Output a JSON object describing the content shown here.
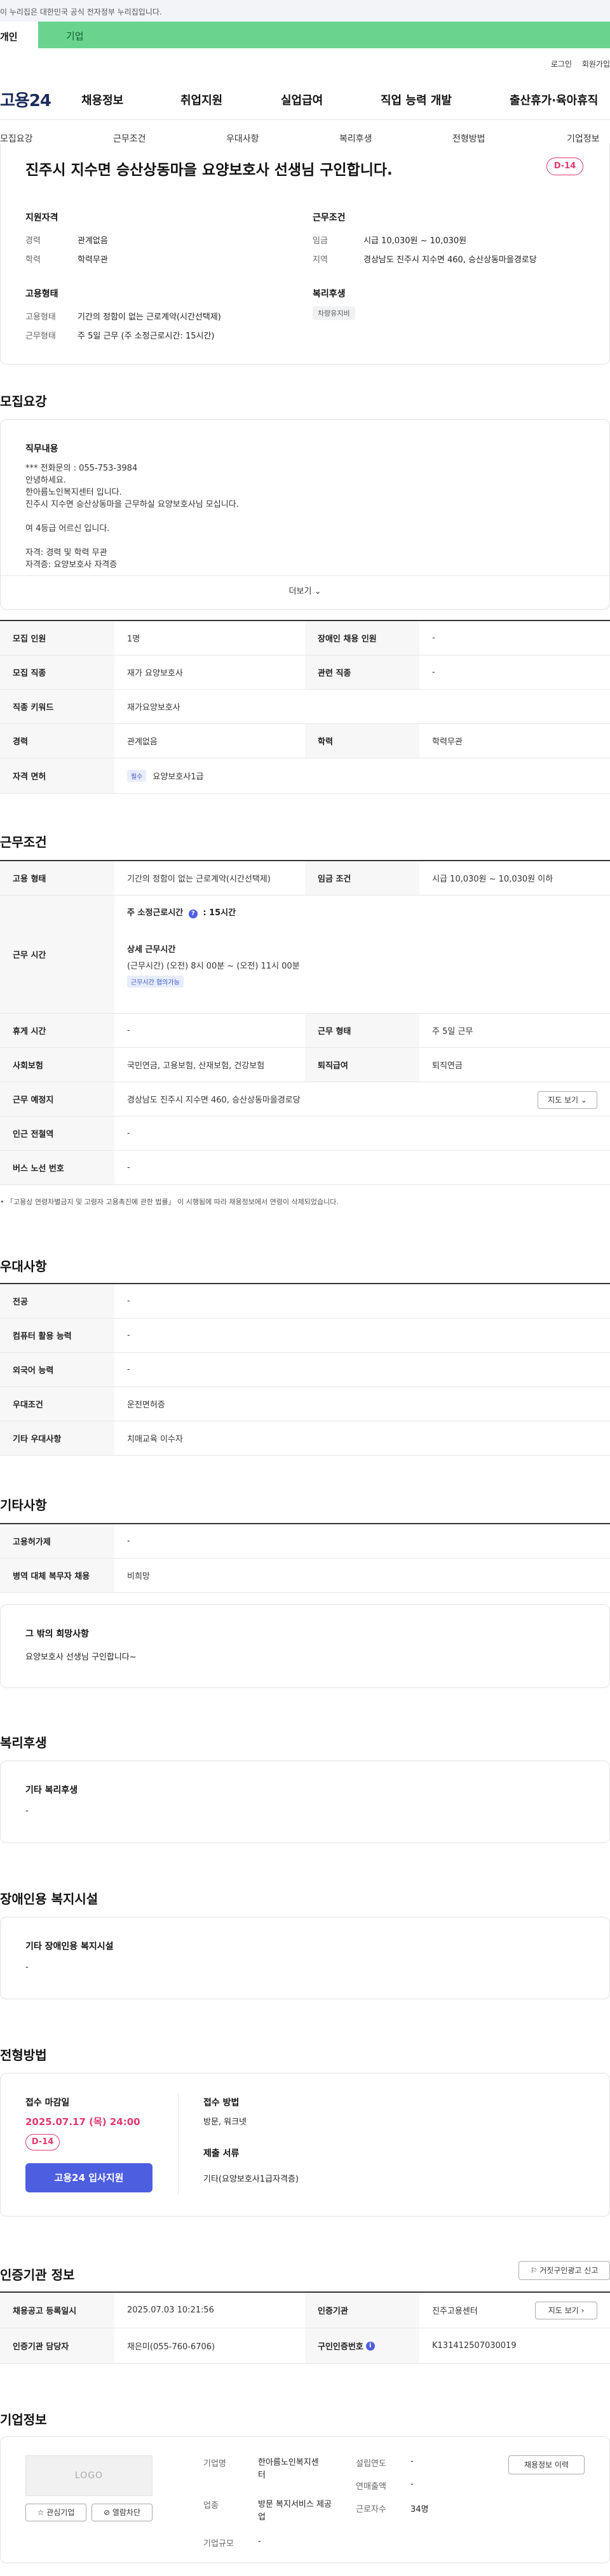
{
  "gov_banner": "이 누리집은 대한민국 공식 전자정부 누리집입니다.",
  "user_types": {
    "person": "개인",
    "company": "기업"
  },
  "util": {
    "login": "로그인",
    "signup": "회원가입"
  },
  "gnb": {
    "logo": "고용24",
    "items": [
      "채용정보",
      "취업지원",
      "실업급여",
      "직업 능력 개발",
      "출산휴가·육아휴직"
    ]
  },
  "subtabs": [
    "모집요강",
    "근무조건",
    "우대사항",
    "복리후생",
    "전형방법",
    "기업정보"
  ],
  "job": {
    "title": "진주시 지수면 승산상동마을 요양보호사 선생님 구인합니다.",
    "dday": "D-14",
    "qual_title": "지원자격",
    "qual": [
      {
        "k": "경력",
        "v": "관계없음"
      },
      {
        "k": "학력",
        "v": "학력무관"
      }
    ],
    "cond_title": "근무조건",
    "cond": [
      {
        "k": "임금",
        "v": "시급 10,030원 ~ 10,030원"
      },
      {
        "k": "지역",
        "v": "경상남도 진주시 지수면 460, 승산상동마을경로당"
      }
    ],
    "emp_title": "고용형태",
    "emp": [
      {
        "k": "고용형태",
        "v": "기간의 정함이 없는 근로계약(시간선택제)"
      },
      {
        "k": "근무형태",
        "v": "주 5일 근무 (주 소정근로시간: 15시간)"
      }
    ],
    "welfare_title": "복리후생",
    "welfare_tag": "차량유지비"
  },
  "recruit": {
    "heading": "모집요강",
    "duty_title": "직무내용",
    "duty_lines": [
      "*** 전화문의 : 055-753-3984",
      "안녕하세요.",
      "한아름노인복지센터 입니다.",
      "진주시 지수면 승산상동마을 근무하실 요양보호사님 모십니다.",
      "",
      "여 4등급 어르신 입니다.",
      "",
      "자격: 경력 및 학력 무관",
      "자격증: 요양보호사 자격증"
    ],
    "more": "더보기",
    "rows": [
      {
        "k1": "모집 인원",
        "v1": "1명",
        "k2": "장애인 채용 인원",
        "v2": "-"
      },
      {
        "k1": "모집 직종",
        "v1": "재가 요양보호사",
        "k2": "관련 직종",
        "v2": "-"
      },
      {
        "k1": "직종 키워드",
        "v1": "재가요양보호사"
      },
      {
        "k1": "경력",
        "v1": "관계없음",
        "k2": "학력",
        "v2": "학력무관"
      },
      {
        "k1": "자격 면허",
        "v1_tag": "필수",
        "v1": "요양보호사1급"
      }
    ]
  },
  "work": {
    "heading": "근무조건",
    "r1": {
      "k1": "고용 형태",
      "v1": "기간의 정함이 없는 근로계약(시간선택제)",
      "k2": "임금 조건",
      "v2": "시급 10,030원 ~ 10,030원 이하"
    },
    "time": {
      "k": "근무 시간",
      "weekly_label": "주 소정근로시간",
      "weekly_value": "15시간",
      "detail_title": "상세 근무시간",
      "detail": "(근무시간) (오전) 8시 00분 ~ (오전) 11시 00분",
      "tag": "근무시간 협의가능"
    },
    "r3": {
      "k1": "휴게 시간",
      "v1": "-",
      "k2": "근무 형태",
      "v2": "주 5일 근무"
    },
    "r4": {
      "k1": "사회보험",
      "v1": "국민연금, 고용보험, 산재보험, 건강보험",
      "k2": "퇴직급여",
      "v2": "퇴직연금"
    },
    "r5": {
      "k1": "근무 예정지",
      "v1": "경상남도 진주시 지수면 460, 승산상동마을경로당",
      "btn": "지도 보기"
    },
    "r6": {
      "k1": "인근 전철역",
      "v1": "-"
    },
    "r7": {
      "k1": "버스 노선 번호",
      "v1": "-"
    },
    "note": "「고용상 연령차별금지 및 고령자 고용촉진에 관한 법률」 이 시행됨에 따라 채용정보에서 연령이 삭제되었습니다."
  },
  "pref": {
    "heading": "우대사항",
    "rows": [
      {
        "k": "전공",
        "v": "-"
      },
      {
        "k": "컴퓨터 활용 능력",
        "v": "-"
      },
      {
        "k": "외국어 능력",
        "v": "-"
      },
      {
        "k": "우대조건",
        "v": "운전면허증"
      },
      {
        "k": "기타 우대사항",
        "v": "치매교육 이수자"
      }
    ]
  },
  "etc": {
    "heading": "기타사항",
    "rows": [
      {
        "k": "고용허가제",
        "v": "-"
      },
      {
        "k": "병역 대체 복무자 채용",
        "v": "비희망"
      }
    ],
    "box_title": "그 밖의 희망사항",
    "box_text": "요양보호사 선생님 구인합니다~"
  },
  "benefit": {
    "heading": "복리후생",
    "box_title": "기타 복리후생",
    "box_text": "-"
  },
  "disability": {
    "heading": "장애인용 복지시설",
    "box_title": "기타 장애인용 복지시설",
    "box_text": "-"
  },
  "selection": {
    "heading": "전형방법",
    "deadline_label": "접수 마감일",
    "deadline": "2025.07.17 (목) 24:00",
    "dday": "D-14",
    "apply_btn": "고용24 입사지원",
    "method_label": "접수 방법",
    "method": "방문, 워크넷",
    "docs_label": "제출 서류",
    "docs": "기타(요양보호사1급자격증)"
  },
  "agency": {
    "heading": "인증기관 정보",
    "report_btn": "거짓구인광고 신고",
    "r1": {
      "k1": "채용공고 등록일시",
      "v1": "2025.07.03 10:21:56",
      "k2": "인증기관",
      "v2": "진주고용센터",
      "btn": "지도 보기"
    },
    "r2": {
      "k1": "인증기관 담당자",
      "v1": "채은미(055-760-6706)",
      "k2": "구인인증번호",
      "v2": "K131412507030019"
    }
  },
  "company": {
    "heading": "기업정보",
    "logo": "LOGO",
    "fav_btn": "관심기업",
    "block_btn": "열람차단",
    "name_k": "기업명",
    "name_v": "한아름노인복지센터",
    "year_k": "설립연도",
    "year_v": "-",
    "sales_k": "연매출액",
    "sales_v": "-",
    "industry_k": "업종",
    "industry_v": "방문 복지서비스 제공업",
    "emp_k": "근로자수",
    "emp_v": "34명",
    "size_k": "기업규모",
    "size_v": "-",
    "history_btn": "채용정보 이력"
  }
}
